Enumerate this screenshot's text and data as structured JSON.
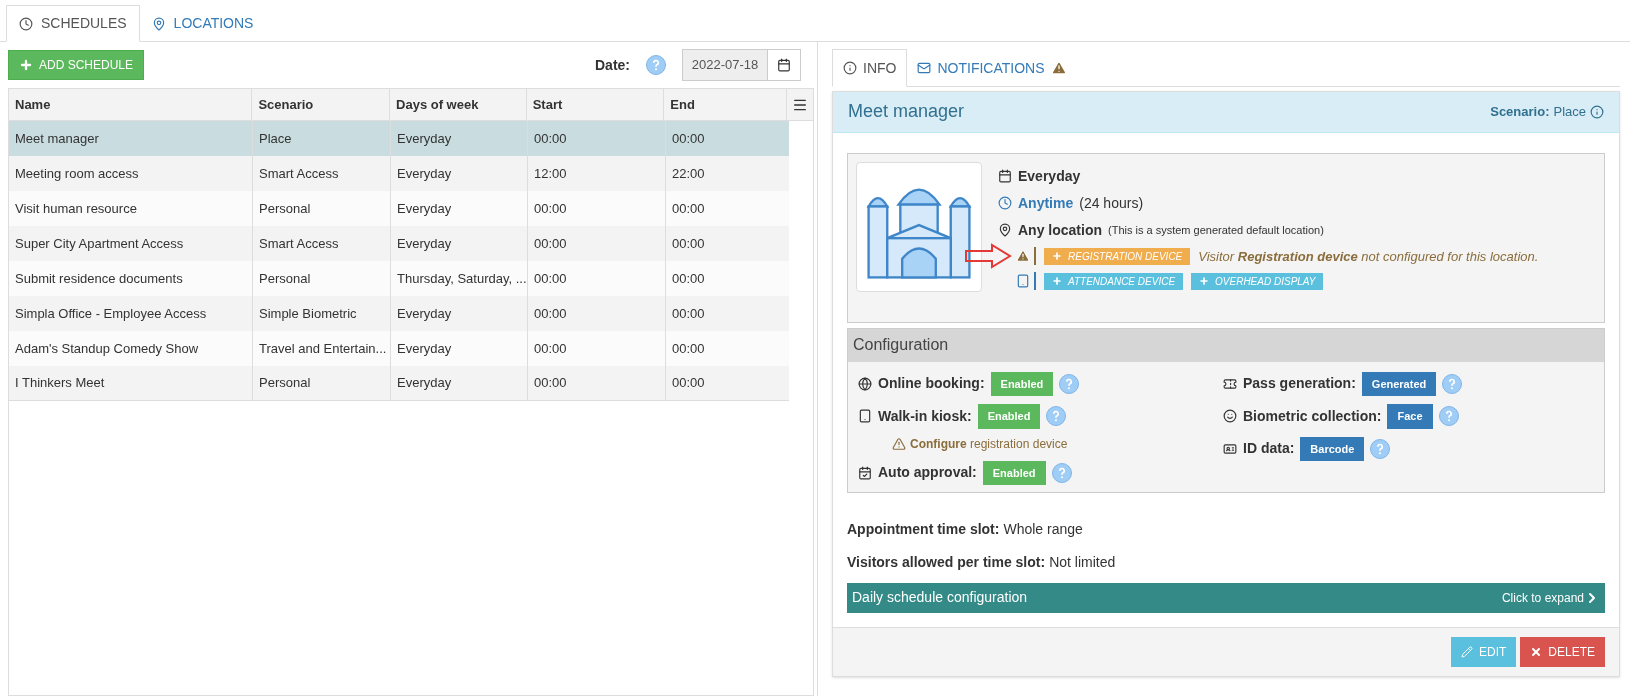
{
  "main_tabs": [
    {
      "label": "SCHEDULES",
      "selected": true
    },
    {
      "label": "LOCATIONS",
      "selected": false
    }
  ],
  "add_button": "ADD SCHEDULE",
  "date": {
    "label": "Date:",
    "value": "2022-07-18"
  },
  "table": {
    "columns": [
      "Name",
      "Scenario",
      "Days of week",
      "Start",
      "End"
    ],
    "rows": [
      {
        "cells": [
          "Meet manager",
          "Place",
          "Everyday",
          "00:00",
          "00:00"
        ],
        "selected": true
      },
      {
        "cells": [
          "Meeting room access",
          "Smart Access",
          "Everyday",
          "12:00",
          "22:00"
        ],
        "selected": false
      },
      {
        "cells": [
          "Visit human resource",
          "Personal",
          "Everyday",
          "00:00",
          "00:00"
        ],
        "selected": false
      },
      {
        "cells": [
          "Super City Apartment Access",
          "Smart Access",
          "Everyday",
          "00:00",
          "00:00"
        ],
        "selected": false
      },
      {
        "cells": [
          "Submit residence documents",
          "Personal",
          "Thursday, Saturday, ...",
          "00:00",
          "00:00"
        ],
        "selected": false
      },
      {
        "cells": [
          "Simpla Office - Employee Access",
          "Simple Biometric",
          "Everyday",
          "00:00",
          "00:00"
        ],
        "selected": false
      },
      {
        "cells": [
          "Adam's Standup Comedy Show",
          "Travel and Entertain...",
          "Everyday",
          "00:00",
          "00:00"
        ],
        "selected": false
      },
      {
        "cells": [
          "I Thinkers Meet",
          "Personal",
          "Everyday",
          "00:00",
          "00:00"
        ],
        "selected": false
      }
    ]
  },
  "detail_tabs": [
    {
      "label": "INFO",
      "selected": true,
      "warning": false
    },
    {
      "label": "NOTIFICATIONS",
      "selected": false,
      "warning": true
    }
  ],
  "detail": {
    "title": "Meet manager",
    "scenario_label": "Scenario:",
    "scenario_value": "Place",
    "days": "Everyday",
    "time": "Anytime",
    "time_note": "(24 hours)",
    "location": "Any location",
    "location_note": "(This is a system generated default location)",
    "device_rows": [
      {
        "kind": "warning",
        "buttons": [
          {
            "label": "REGISTRATION DEVICE",
            "warning": true
          }
        ],
        "message": "Visitor **Registration device** not configured for this location."
      },
      {
        "kind": "device",
        "buttons": [
          {
            "label": "ATTENDANCE DEVICE",
            "warning": false
          },
          {
            "label": "OVERHEAD DISPLAY",
            "warning": false
          }
        ]
      }
    ]
  },
  "configuration": {
    "title": "Configuration",
    "left": [
      {
        "label": "Online booking:",
        "value": "Enabled",
        "kind": "success"
      },
      {
        "label": "Walk-in kiosk:",
        "value": "Enabled",
        "kind": "success",
        "note": "**Configure** registration device"
      },
      {
        "label": "Auto approval:",
        "value": "Enabled",
        "kind": "success"
      }
    ],
    "right": [
      {
        "label": "Pass generation:",
        "value": "Generated",
        "kind": "primary"
      },
      {
        "label": "Biometric collection:",
        "value": "Face",
        "kind": "primary"
      },
      {
        "label": "ID data:",
        "value": "Barcode",
        "kind": "primary"
      }
    ]
  },
  "appointment": {
    "label": "Appointment time slot:",
    "value": "Whole range"
  },
  "visitors": {
    "label": "Visitors allowed per time slot:",
    "value": "Not limited"
  },
  "daily": {
    "title": "Daily schedule configuration",
    "action": "Click to expand"
  },
  "buttons": [
    {
      "label": "EDIT",
      "kind": "edit"
    },
    {
      "label": "DELETE",
      "kind": "delete"
    }
  ]
}
